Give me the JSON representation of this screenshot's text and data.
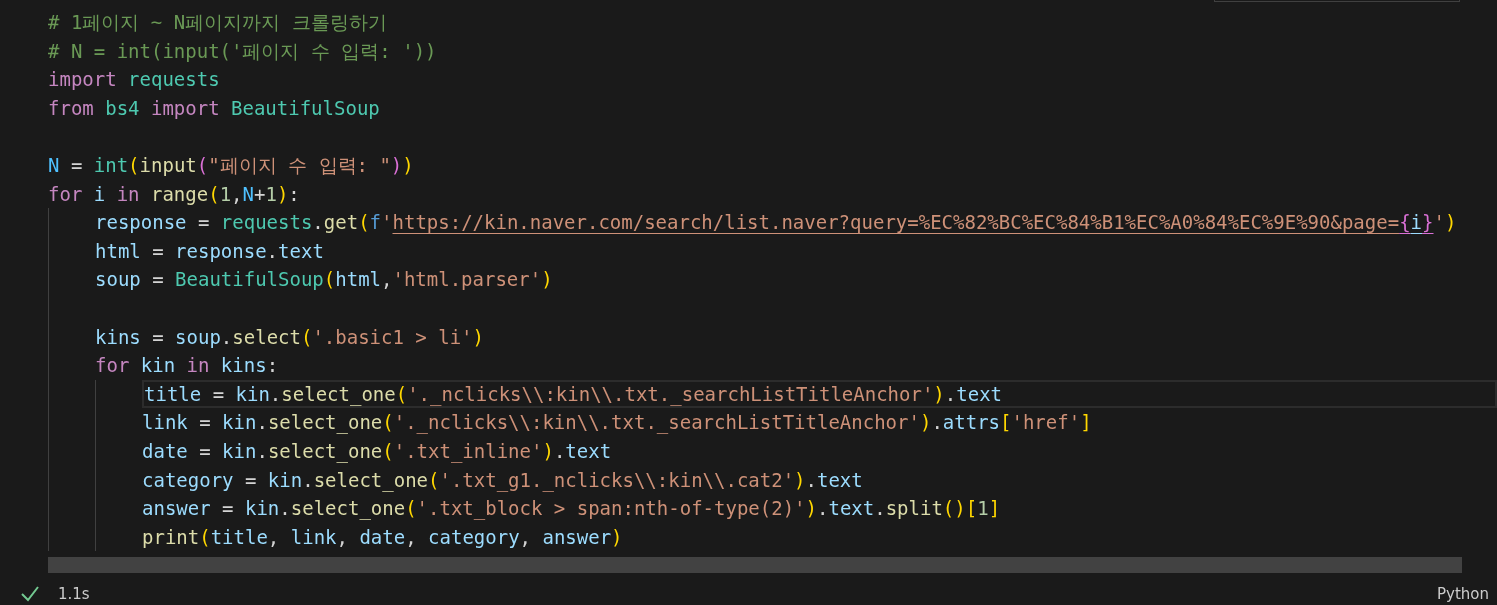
{
  "toolbar_frame": true,
  "cell": {
    "lines": [
      {
        "current": false,
        "tokens": [
          {
            "t": "# 1페이지 ~ N페이지까지 크롤링하기",
            "kind": "comment"
          }
        ]
      },
      {
        "current": false,
        "tokens": [
          {
            "t": "# N = int(input('페이지 수 입력: '))",
            "kind": "comment"
          }
        ]
      },
      {
        "current": false,
        "tokens": [
          {
            "t": "import",
            "kind": "keyword"
          },
          {
            "t": " requests",
            "kind": "module"
          }
        ]
      },
      {
        "current": false,
        "tokens": [
          {
            "t": "from",
            "kind": "keyword"
          },
          {
            "t": " bs4",
            "kind": "module"
          },
          {
            "t": " import",
            "kind": "keyword"
          },
          {
            "t": " BeautifulSoup",
            "kind": "module"
          }
        ]
      },
      {
        "current": false
      },
      {
        "current": false,
        "tokens": [
          {
            "t": "N",
            "kind": "const"
          },
          {
            "t": " = ",
            "kind": "plain"
          },
          {
            "t": "int",
            "kind": "module"
          },
          {
            "t": "(",
            "kind": "bracket1"
          },
          {
            "t": "input",
            "kind": "func"
          },
          {
            "t": "(",
            "kind": "bracket2"
          },
          {
            "t": "\"페이지 수 입력: \"",
            "kind": "string"
          },
          {
            "t": ")",
            "kind": "bracket2"
          },
          {
            "t": ")",
            "kind": "bracket1"
          }
        ]
      },
      {
        "current": false,
        "tokens": [
          {
            "t": "for",
            "kind": "keyword"
          },
          {
            "t": " i",
            "kind": "var"
          },
          {
            "t": " in",
            "kind": "keyword"
          },
          {
            "t": " range",
            "kind": "func"
          },
          {
            "t": "(",
            "kind": "bracket1"
          },
          {
            "t": "1",
            "kind": "number"
          },
          {
            "t": ",",
            "kind": "plain"
          },
          {
            "t": "N",
            "kind": "const"
          },
          {
            "t": "+",
            "kind": "plain"
          },
          {
            "t": "1",
            "kind": "number"
          },
          {
            "t": ")",
            "kind": "bracket1"
          },
          {
            "t": ":",
            "kind": "plain"
          }
        ],
        "children": [
          {
            "current": false,
            "tokens": [
              {
                "t": "response",
                "kind": "var"
              },
              {
                "t": " = ",
                "kind": "plain"
              },
              {
                "t": "requests",
                "kind": "module"
              },
              {
                "t": ".",
                "kind": "plain"
              },
              {
                "t": "get",
                "kind": "func"
              },
              {
                "t": "(",
                "kind": "bracket1"
              },
              {
                "t": "f",
                "kind": "storage"
              },
              {
                "t": "'",
                "kind": "string"
              },
              {
                "t": "https://kin.naver.com/search/list.naver?query=%EC%82%BC%EC%84%B1%EC%A0%84%EC%9E%90&page=",
                "kind": "string",
                "link": true
              },
              {
                "t": "{",
                "kind": "bracket2",
                "link": true
              },
              {
                "t": "i",
                "kind": "var",
                "link": true
              },
              {
                "t": "}",
                "kind": "bracket2",
                "link": true
              },
              {
                "t": "'",
                "kind": "string"
              },
              {
                "t": ")",
                "kind": "bracket1"
              }
            ]
          },
          {
            "current": false,
            "tokens": [
              {
                "t": "html",
                "kind": "var"
              },
              {
                "t": " = ",
                "kind": "plain"
              },
              {
                "t": "response",
                "kind": "var"
              },
              {
                "t": ".",
                "kind": "plain"
              },
              {
                "t": "text",
                "kind": "var"
              }
            ]
          },
          {
            "current": false,
            "tokens": [
              {
                "t": "soup",
                "kind": "var"
              },
              {
                "t": " = ",
                "kind": "plain"
              },
              {
                "t": "BeautifulSoup",
                "kind": "module"
              },
              {
                "t": "(",
                "kind": "bracket1"
              },
              {
                "t": "html",
                "kind": "var"
              },
              {
                "t": ",",
                "kind": "plain"
              },
              {
                "t": "'html.parser'",
                "kind": "string"
              },
              {
                "t": ")",
                "kind": "bracket1"
              }
            ]
          },
          {
            "current": false
          },
          {
            "current": false,
            "tokens": [
              {
                "t": "kins",
                "kind": "var"
              },
              {
                "t": " = ",
                "kind": "plain"
              },
              {
                "t": "soup",
                "kind": "var"
              },
              {
                "t": ".",
                "kind": "plain"
              },
              {
                "t": "select",
                "kind": "func"
              },
              {
                "t": "(",
                "kind": "bracket1"
              },
              {
                "t": "'.basic1 > li'",
                "kind": "string"
              },
              {
                "t": ")",
                "kind": "bracket1"
              }
            ]
          },
          {
            "current": false,
            "tokens": [
              {
                "t": "for",
                "kind": "keyword"
              },
              {
                "t": " kin",
                "kind": "var"
              },
              {
                "t": " in",
                "kind": "keyword"
              },
              {
                "t": " kins",
                "kind": "var"
              },
              {
                "t": ":",
                "kind": "plain"
              }
            ],
            "children": [
              {
                "current": true,
                "tokens": [
                  {
                    "t": "title",
                    "kind": "var"
                  },
                  {
                    "t": " = ",
                    "kind": "plain"
                  },
                  {
                    "t": "kin",
                    "kind": "var"
                  },
                  {
                    "t": ".",
                    "kind": "plain"
                  },
                  {
                    "t": "select_one",
                    "kind": "func"
                  },
                  {
                    "t": "(",
                    "kind": "bracket1"
                  },
                  {
                    "t": "'._nclicks\\\\:kin\\\\.txt._searchListTitleAnchor'",
                    "kind": "string"
                  },
                  {
                    "t": ")",
                    "kind": "bracket1"
                  },
                  {
                    "t": ".",
                    "kind": "plain"
                  },
                  {
                    "t": "text",
                    "kind": "var"
                  }
                ]
              },
              {
                "current": false,
                "tokens": [
                  {
                    "t": "link",
                    "kind": "var"
                  },
                  {
                    "t": " = ",
                    "kind": "plain"
                  },
                  {
                    "t": "kin",
                    "kind": "var"
                  },
                  {
                    "t": ".",
                    "kind": "plain"
                  },
                  {
                    "t": "select_one",
                    "kind": "func"
                  },
                  {
                    "t": "(",
                    "kind": "bracket1"
                  },
                  {
                    "t": "'._nclicks\\\\:kin\\\\.txt._searchListTitleAnchor'",
                    "kind": "string"
                  },
                  {
                    "t": ")",
                    "kind": "bracket1"
                  },
                  {
                    "t": ".",
                    "kind": "plain"
                  },
                  {
                    "t": "attrs",
                    "kind": "var"
                  },
                  {
                    "t": "[",
                    "kind": "bracket1"
                  },
                  {
                    "t": "'href'",
                    "kind": "string"
                  },
                  {
                    "t": "]",
                    "kind": "bracket1"
                  }
                ]
              },
              {
                "current": false,
                "tokens": [
                  {
                    "t": "date",
                    "kind": "var"
                  },
                  {
                    "t": " = ",
                    "kind": "plain"
                  },
                  {
                    "t": "kin",
                    "kind": "var"
                  },
                  {
                    "t": ".",
                    "kind": "plain"
                  },
                  {
                    "t": "select_one",
                    "kind": "func"
                  },
                  {
                    "t": "(",
                    "kind": "bracket1"
                  },
                  {
                    "t": "'.txt_inline'",
                    "kind": "string"
                  },
                  {
                    "t": ")",
                    "kind": "bracket1"
                  },
                  {
                    "t": ".",
                    "kind": "plain"
                  },
                  {
                    "t": "text",
                    "kind": "var"
                  }
                ]
              },
              {
                "current": false,
                "tokens": [
                  {
                    "t": "category",
                    "kind": "var"
                  },
                  {
                    "t": " = ",
                    "kind": "plain"
                  },
                  {
                    "t": "kin",
                    "kind": "var"
                  },
                  {
                    "t": ".",
                    "kind": "plain"
                  },
                  {
                    "t": "select_one",
                    "kind": "func"
                  },
                  {
                    "t": "(",
                    "kind": "bracket1"
                  },
                  {
                    "t": "'.txt_g1._nclicks\\\\:kin\\\\.cat2'",
                    "kind": "string"
                  },
                  {
                    "t": ")",
                    "kind": "bracket1"
                  },
                  {
                    "t": ".",
                    "kind": "plain"
                  },
                  {
                    "t": "text",
                    "kind": "var"
                  }
                ]
              },
              {
                "current": false,
                "tokens": [
                  {
                    "t": "answer",
                    "kind": "var"
                  },
                  {
                    "t": " = ",
                    "kind": "plain"
                  },
                  {
                    "t": "kin",
                    "kind": "var"
                  },
                  {
                    "t": ".",
                    "kind": "plain"
                  },
                  {
                    "t": "select_one",
                    "kind": "func"
                  },
                  {
                    "t": "(",
                    "kind": "bracket1"
                  },
                  {
                    "t": "'.txt_block > span:nth-of-type(2)'",
                    "kind": "string"
                  },
                  {
                    "t": ")",
                    "kind": "bracket1"
                  },
                  {
                    "t": ".",
                    "kind": "plain"
                  },
                  {
                    "t": "text",
                    "kind": "var"
                  },
                  {
                    "t": ".",
                    "kind": "plain"
                  },
                  {
                    "t": "split",
                    "kind": "func"
                  },
                  {
                    "t": "(",
                    "kind": "bracket1"
                  },
                  {
                    "t": ")",
                    "kind": "bracket1"
                  },
                  {
                    "t": "[",
                    "kind": "bracket1"
                  },
                  {
                    "t": "1",
                    "kind": "number"
                  },
                  {
                    "t": "]",
                    "kind": "bracket1"
                  }
                ]
              },
              {
                "current": false,
                "tokens": [
                  {
                    "t": "print",
                    "kind": "func"
                  },
                  {
                    "t": "(",
                    "kind": "bracket1"
                  },
                  {
                    "t": "title",
                    "kind": "var"
                  },
                  {
                    "t": ", ",
                    "kind": "plain"
                  },
                  {
                    "t": "link",
                    "kind": "var"
                  },
                  {
                    "t": ", ",
                    "kind": "plain"
                  },
                  {
                    "t": "date",
                    "kind": "var"
                  },
                  {
                    "t": ", ",
                    "kind": "plain"
                  },
                  {
                    "t": "category",
                    "kind": "var"
                  },
                  {
                    "t": ", ",
                    "kind": "plain"
                  },
                  {
                    "t": "answer",
                    "kind": "var"
                  },
                  {
                    "t": ")",
                    "kind": "bracket1"
                  }
                ]
              }
            ]
          }
        ]
      }
    ]
  },
  "status": {
    "succeeded": true,
    "duration": "1.1s",
    "language": "Python"
  }
}
